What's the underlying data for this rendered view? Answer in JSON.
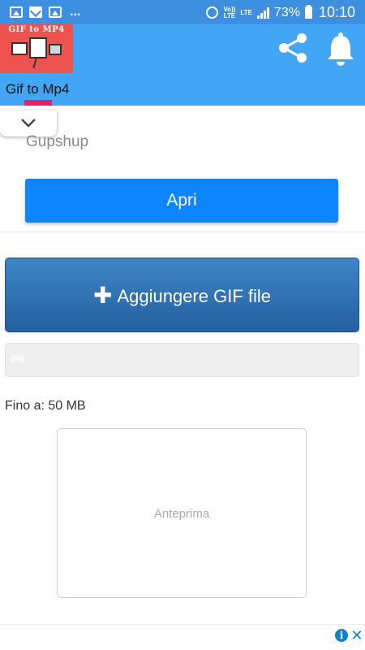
{
  "status_bar": {
    "notification_icons": [
      "gallery-icon",
      "mail-icon",
      "gallery-icon"
    ],
    "overflow": "...",
    "volte_label": "Vo))",
    "lte_small": "LTE",
    "lte_label": "LTE",
    "battery": "73%",
    "time": "10:10"
  },
  "app_bar": {
    "logo_text": "GIF to MP4",
    "title": "Gif to Mp4",
    "share_icon": "share-icon",
    "bell_icon": "bell-icon",
    "colors": {
      "bar": "#42a5f5",
      "status": "#3d8fe0",
      "indicator": "#e91e63"
    }
  },
  "ad_card": {
    "advertiser": "Gupshup",
    "cta": "Apri"
  },
  "uploader": {
    "add_button_label": "Aggiungere GIF file",
    "progress_text": "0%",
    "progress_value": 0,
    "limit_text": "Fino a: 50 MB",
    "preview_placeholder": "Anteprima"
  },
  "bottom_ad": {
    "info_icon": "info-icon",
    "close_icon": "close-icon",
    "info_glyph": "i",
    "close_glyph": "✕"
  }
}
